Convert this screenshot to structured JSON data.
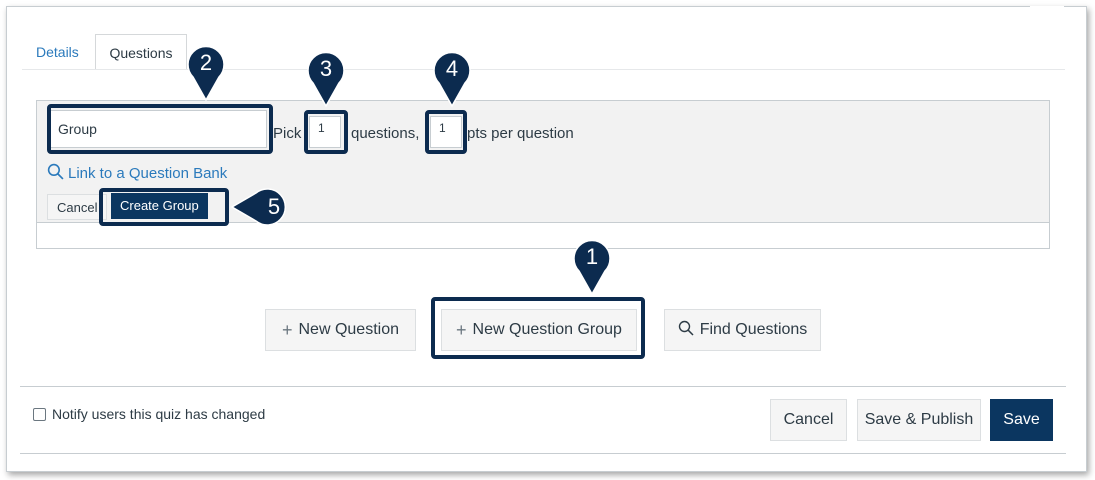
{
  "tabs": [
    {
      "label": "Details"
    },
    {
      "label": "Questions"
    }
  ],
  "group_form": {
    "name_value": "Group",
    "pick_label": "Pick",
    "pick_value": "1",
    "questions_label": "questions,",
    "pts_value": "1",
    "pts_label": "pts per question",
    "bank_link": "Link to a Question Bank",
    "cancel_label": "Cancel",
    "create_label": "Create Group"
  },
  "callouts": [
    "1",
    "2",
    "3",
    "4",
    "5"
  ],
  "actions": {
    "new_question": "New Question",
    "new_question_group": "New Question Group",
    "find_questions": "Find Questions"
  },
  "footer": {
    "notify_label": "Notify users this quiz has changed",
    "cancel": "Cancel",
    "save_publish": "Save & Publish",
    "save": "Save"
  },
  "colors": {
    "link": "#2b7abc",
    "primary": "#0b3660",
    "callout": "#0c2b4f"
  },
  "icons": {
    "bank_link": "search-icon",
    "find_questions": "search-icon",
    "add": "plus-icon"
  }
}
